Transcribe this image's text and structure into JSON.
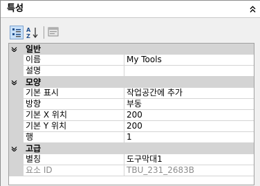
{
  "panel": {
    "title": "특성",
    "collapse_icon": "double-chevron-up-icon"
  },
  "toolbar": {
    "buttons": [
      {
        "name": "categorized",
        "icon": "categorized-view-icon",
        "active": true
      },
      {
        "name": "alphabetical",
        "icon": "sort-az-icon",
        "active": false
      },
      {
        "name": "property-pages",
        "icon": "property-pages-icon",
        "active": false
      }
    ]
  },
  "grid": {
    "categories": [
      {
        "label": "일반",
        "properties": [
          {
            "name": "이름",
            "value": "My Tools"
          },
          {
            "name": "설명",
            "value": ""
          }
        ]
      },
      {
        "label": "모양",
        "properties": [
          {
            "name": "기본 표시",
            "value": "작업공간에 추가"
          },
          {
            "name": "방향",
            "value": "부동"
          },
          {
            "name": "기본 X 위치",
            "value": "200"
          },
          {
            "name": "기본 Y 위치",
            "value": "200"
          },
          {
            "name": "행",
            "value": "1"
          }
        ]
      },
      {
        "label": "고급",
        "properties": [
          {
            "name": "별칭",
            "value": "도구막대1"
          },
          {
            "name": "요소 ID",
            "value": "TBU_231_2683B",
            "disabled": true
          }
        ]
      }
    ]
  }
}
